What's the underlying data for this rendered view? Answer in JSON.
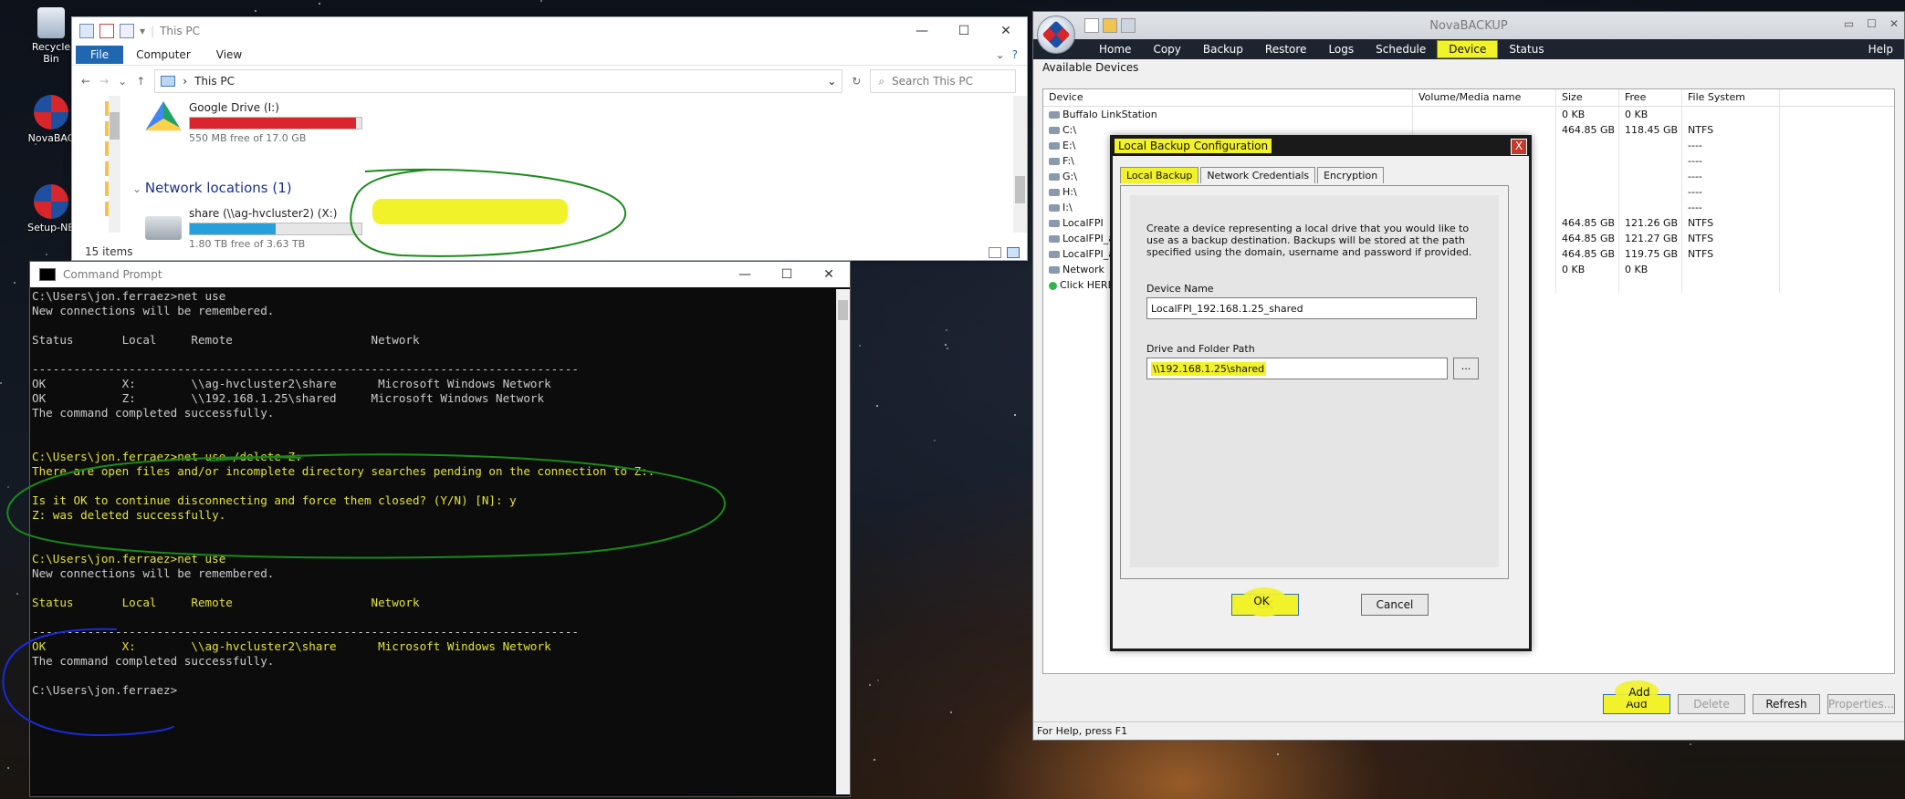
{
  "desktop": {
    "icons": [
      {
        "name": "recycle-bin-icon",
        "label": "Recycle Bin"
      },
      {
        "name": "novabackup-icon",
        "label": "NovaBAC"
      },
      {
        "name": "setup-icon",
        "label": "Setup-NB"
      }
    ]
  },
  "explorer": {
    "title": "This PC",
    "ribbon": {
      "file": "File",
      "computer": "Computer",
      "view": "View"
    },
    "address": "This PC",
    "search_placeholder": "Search This PC",
    "drives": [
      {
        "name": "Google Drive (I:)",
        "free": "550 MB free of 17.0 GB",
        "used_fraction": 0.97,
        "color": "#d9262e"
      },
      {
        "name": "share (\\\\ag-hvcluster2) (X:)",
        "free": "1.80 TB free of 3.63 TB",
        "used_fraction": 0.5,
        "color": "#26a0da"
      }
    ],
    "network_heading": "Network locations (1)",
    "status": "15 items"
  },
  "cmd": {
    "title": "Command Prompt",
    "lines": [
      {
        "text": "C:\\Users\\jon.ferraez>net use",
        "hl": false
      },
      {
        "text": "New connections will be remembered.",
        "hl": false
      },
      {
        "text": "",
        "hl": false
      },
      {
        "text": "Status       Local     Remote                    Network",
        "hl": false
      },
      {
        "text": "",
        "hl": false
      },
      {
        "text": "-------------------------------------------------------------------------------",
        "hl": false
      },
      {
        "text": "OK           X:        \\\\ag-hvcluster2\\share      Microsoft Windows Network",
        "hl": false
      },
      {
        "text": "OK           Z:        \\\\192.168.1.25\\shared     Microsoft Windows Network",
        "hl": false
      },
      {
        "text": "The command completed successfully.",
        "hl": false
      },
      {
        "text": "",
        "hl": false
      },
      {
        "text": "",
        "hl": false
      },
      {
        "text": "C:\\Users\\jon.ferraez>net use /delete Z:",
        "hl": true
      },
      {
        "text": "There are open files and/or incomplete directory searches pending on the connection to Z:.",
        "hl": true
      },
      {
        "text": "",
        "hl": false
      },
      {
        "text": "Is it OK to continue disconnecting and force them closed? (Y/N) [N]: y",
        "hl": true
      },
      {
        "text": "Z: was deleted successfully.",
        "hl": true
      },
      {
        "text": "",
        "hl": false
      },
      {
        "text": "",
        "hl": false
      },
      {
        "text": "C:\\Users\\jon.ferraez>net use",
        "hl": true
      },
      {
        "text": "New connections will be remembered.",
        "hl": false
      },
      {
        "text": "",
        "hl": false
      },
      {
        "text": "Status       Local     Remote                    Network",
        "hl": true
      },
      {
        "text": "",
        "hl": false
      },
      {
        "text": "-------------------------------------------------------------------------------",
        "hl": false
      },
      {
        "text": "OK           X:        \\\\ag-hvcluster2\\share      Microsoft Windows Network",
        "hl": true
      },
      {
        "text": "The command completed successfully.",
        "hl": false
      },
      {
        "text": "",
        "hl": false
      },
      {
        "text": "C:\\Users\\jon.ferraez>",
        "hl": false
      }
    ]
  },
  "nova": {
    "title": "NovaBACKUP",
    "menu": [
      "Home",
      "Copy",
      "Backup",
      "Restore",
      "Logs",
      "Schedule",
      "Device",
      "Status"
    ],
    "active_menu": "Device",
    "help": "Help",
    "available_devices": "Available Devices",
    "columns": [
      "Device",
      "Volume/Media name",
      "Size",
      "Free",
      "File System"
    ],
    "devices": [
      {
        "device": "Buffalo LinkStation",
        "volume": "",
        "size": "0 KB",
        "free": "0 KB",
        "fs": ""
      },
      {
        "device": "C:\\",
        "volume": "",
        "size": "464.85 GB",
        "free": "118.45 GB",
        "fs": "NTFS"
      },
      {
        "device": "E:\\",
        "volume": "",
        "size": "",
        "free": "",
        "fs": "----"
      },
      {
        "device": "F:\\",
        "volume": "",
        "size": "",
        "free": "",
        "fs": "----"
      },
      {
        "device": "G:\\",
        "volume": "",
        "size": "",
        "free": "",
        "fs": "----"
      },
      {
        "device": "H:\\",
        "volume": "",
        "size": "",
        "free": "",
        "fs": "----"
      },
      {
        "device": "I:\\",
        "volume": "",
        "size": "",
        "free": "",
        "fs": "----"
      },
      {
        "device": "LocalFPI",
        "volume": "",
        "size": "464.85 GB",
        "free": "121.26 GB",
        "fs": "NTFS"
      },
      {
        "device": "LocalFPI_a",
        "volume": "",
        "size": "464.85 GB",
        "free": "121.27 GB",
        "fs": "NTFS"
      },
      {
        "device": "LocalFPI_a",
        "volume": "",
        "size": "464.85 GB",
        "free": "119.75 GB",
        "fs": "NTFS"
      },
      {
        "device": "Network",
        "volume": "",
        "size": "0 KB",
        "free": "0 KB",
        "fs": ""
      },
      {
        "device": "Click HERE",
        "volume": "",
        "size": "",
        "free": "",
        "fs": ""
      }
    ],
    "buttons": {
      "add": "Add",
      "delete": "Delete",
      "refresh": "Refresh",
      "properties": "Properties..."
    },
    "status_bar": "For Help, press F1"
  },
  "dialog": {
    "title": "Local Backup Configuration",
    "close": "X",
    "tabs": [
      "Local Backup",
      "Network Credentials",
      "Encryption"
    ],
    "description": "Create a device representing a local drive that you would like to use as a backup destination. Backups will be stored at the path specified using the domain, username and password if provided.",
    "device_name_label": "Device Name",
    "device_name_value": "LocalFPI_192.168.1.25_shared",
    "path_label": "Drive and Folder Path",
    "path_value": "\\\\192.168.1.25\\shared",
    "browse": "...",
    "ok": "OK",
    "cancel": "Cancel"
  },
  "highlight_color": "#f2f22a"
}
